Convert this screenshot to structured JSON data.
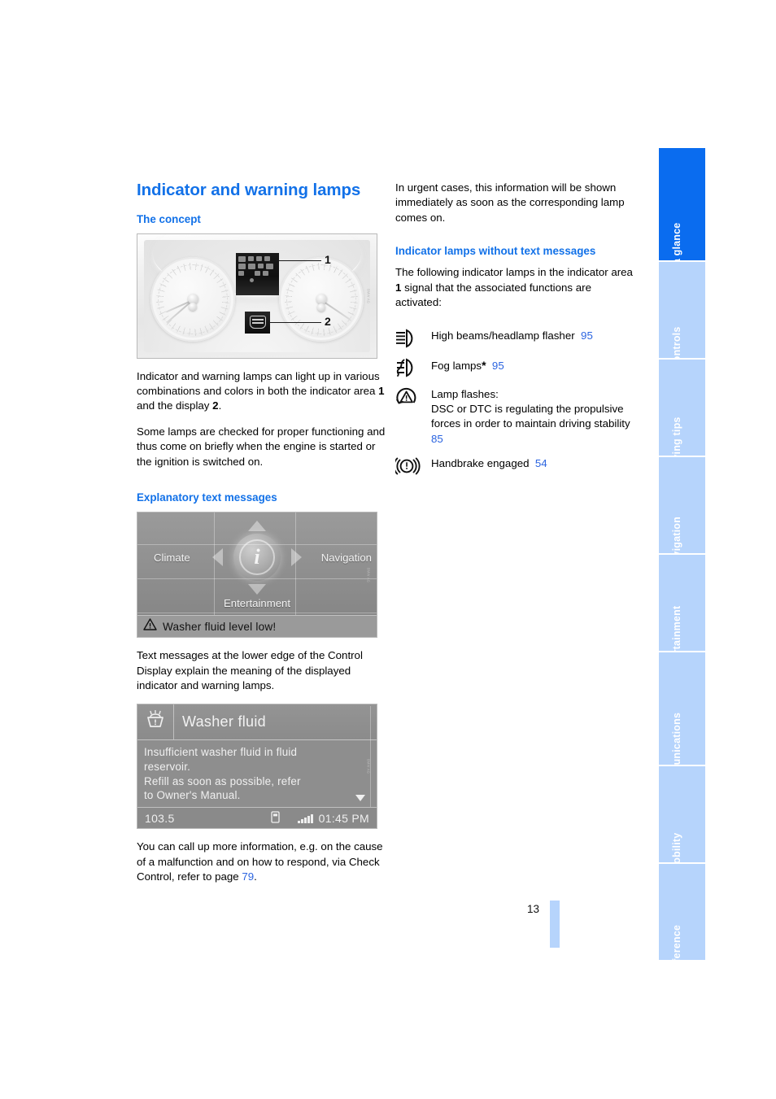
{
  "page": {
    "number": "13",
    "title": "Indicator and warning lamps"
  },
  "left_column": {
    "section_concept": {
      "heading": "The concept",
      "paragraphs": [
        "Indicator and warning lamps can light up in various combinations and colors in both the indicator area 1 and the display 2.",
        "Some lamps are checked for proper functioning and thus come on briefly when the engine is started or the ignition is switched on."
      ],
      "figure": {
        "name": "instrument-cluster",
        "callout_1": "1",
        "callout_2": "2"
      }
    },
    "section_text_messages": {
      "heading": "Explanatory text messages",
      "idrive_figure": {
        "menu_items": [
          "Climate",
          "Navigation",
          "Entertainment"
        ],
        "center_icon": "info-icon",
        "warning_message": "Washer fluid level low!"
      },
      "paragraph_1": "Text messages at the lower edge of the Control Display explain the meaning of the displayed indicator and warning lamps.",
      "washer_figure": {
        "title": "Washer fluid",
        "body_lines": [
          "Insufficient washer fluid in fluid",
          "reservoir.",
          "Refill as soon as possible, refer",
          "to Owner's Manual."
        ],
        "status_left": "103.5",
        "status_time": "01:45 PM"
      },
      "paragraph_2_pre": "You can call up more information, e.g. on the cause of a malfunction and on how to respond, via Check Control, refer to page ",
      "paragraph_2_ref": "79",
      "paragraph_2_post": "."
    }
  },
  "right_column": {
    "intro": "In urgent cases, this information will be shown immediately as soon as the corresponding lamp comes on.",
    "section_heading": "Indicator lamps without text messages",
    "section_intro": "The following indicator lamps in the indicator area 1 signal that the associated functions are activated:",
    "lamps": [
      {
        "icon": "high-beam-icon",
        "text": "High beams/headlamp flasher",
        "page_ref": "95"
      },
      {
        "icon": "fog-lamp-icon",
        "text": "Fog lamps",
        "asterisk": "*",
        "page_ref": "95"
      },
      {
        "icon": "dsc-dtc-icon",
        "line1": "Lamp flashes:",
        "text": "DSC or DTC is regulating the propulsive forces in order to maintain driving stability",
        "page_ref": "85"
      },
      {
        "icon": "handbrake-icon",
        "text": "Handbrake engaged",
        "page_ref": "54"
      }
    ]
  },
  "tabs": [
    {
      "label": "At a glance",
      "active": true
    },
    {
      "label": "Controls",
      "active": false
    },
    {
      "label": "Driving tips",
      "active": false
    },
    {
      "label": "Navigation",
      "active": false
    },
    {
      "label": "Entertainment",
      "active": false
    },
    {
      "label": "Communications",
      "active": false
    },
    {
      "label": "Mobility",
      "active": false
    },
    {
      "label": "Reference",
      "active": false
    }
  ],
  "colors": {
    "heading_blue": "#1271E8",
    "ref_blue": "#2B64E0",
    "tab_active": "#0a6cef",
    "tab_inactive": "#b6d4fc"
  }
}
